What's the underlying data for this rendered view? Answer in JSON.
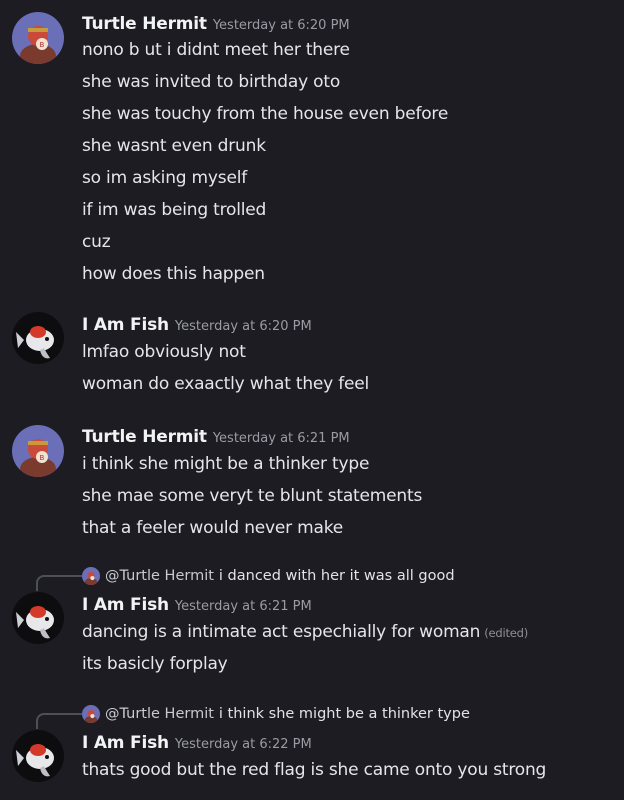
{
  "messages": [
    {
      "author": "Turtle Hermit",
      "timestamp": "Yesterday at 6:20 PM",
      "avatar": "turtle-hermit-avatar",
      "lines": [
        "nono b ut i didnt meet her there",
        "she was invited to birthday oto",
        "she was touchy from the house even before",
        "she wasnt even drunk",
        "so im asking myself",
        "if im was being trolled",
        "cuz",
        "how does this happen"
      ]
    },
    {
      "author": "I Am Fish",
      "timestamp": "Yesterday at 6:20 PM",
      "avatar": "fish-avatar",
      "lines": [
        "lmfao obviously not",
        "woman do exaactly what they feel"
      ]
    },
    {
      "author": "Turtle Hermit",
      "timestamp": "Yesterday at 6:21 PM",
      "avatar": "turtle-hermit-avatar",
      "lines": [
        "i think she might be a thinker type",
        "she mae some veryt te blunt statements",
        "that a feeler would never make"
      ]
    },
    {
      "reply_to": {
        "author": "@Turtle Hermit",
        "text": "i danced with her it was all good"
      },
      "author": "I Am Fish",
      "timestamp": "Yesterday at 6:21 PM",
      "avatar": "fish-avatar",
      "lines": [
        "dancing is a intimate act espechially for woman",
        "its basicly forplay"
      ],
      "edited_label": "(edited)"
    },
    {
      "reply_to": {
        "author": "@Turtle Hermit",
        "text": "i think she might be a thinker type"
      },
      "author": "I Am Fish",
      "timestamp": "Yesterday at 6:22 PM",
      "avatar": "fish-avatar",
      "lines": [
        "thats good but the red flag is she came onto you strong"
      ]
    }
  ],
  "colors": {
    "background": "#1c1c22",
    "author": "#f2f3f5",
    "timestamp": "#9a9ba4",
    "text": "#e6e6ea"
  }
}
